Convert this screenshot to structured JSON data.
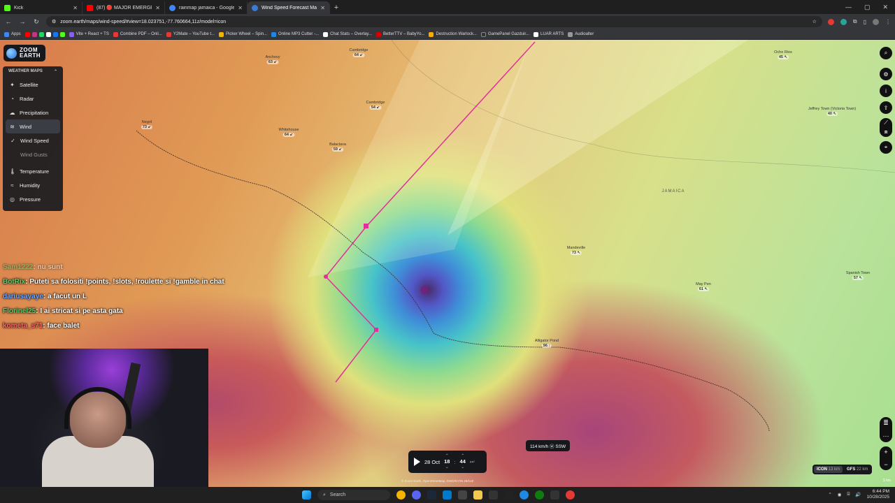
{
  "browser": {
    "tabs": [
      {
        "title": "Kick",
        "color": "#53fc18"
      },
      {
        "title": "(87) 🔴 MAJOR EMERGEN...",
        "color": "#ff0000"
      },
      {
        "title": "rainmap jamaica - Google Sear...",
        "color": "#4285f4"
      },
      {
        "title": "Wind Speed Forecast Map | Zo...",
        "color": "#3a7bd5"
      }
    ],
    "new_tab": "+",
    "url": "zoom.earth/maps/wind-speed/#view=18.023751,-77.760664,11z/model=icon",
    "bookmarks": [
      {
        "label": "Apps",
        "color": "#4285f4"
      },
      {
        "label": "",
        "color": "#ff0000"
      },
      {
        "label": "Vite + React + TS",
        "color": "#8b5cf6"
      },
      {
        "label": "Combine PDF – Onli...",
        "color": "#e53935"
      },
      {
        "label": "Y2Mate – YouTube t...",
        "color": "#e53935"
      },
      {
        "label": "Picker Wheel – Spin...",
        "color": "#f5b400"
      },
      {
        "label": "Online MP3 Cutter -...",
        "color": "#1e88e5"
      },
      {
        "label": "Chat Stats – Overlay...",
        "color": "#ffffff"
      },
      {
        "label": "BetterTTV – BabyYo...",
        "color": "#d50000"
      },
      {
        "label": "Destruction Warlock...",
        "color": "#ffaa00"
      },
      {
        "label": "GamePanel Gazduir...",
        "color": "#333333"
      },
      {
        "label": "LUAR ARTS",
        "color": "#ffffff"
      },
      {
        "label": "Audioalter",
        "color": "#999999"
      }
    ]
  },
  "app": {
    "logo_line1": "ZOOM",
    "logo_line2": "EARTH",
    "panel_header": "WEATHER MAPS",
    "layers": [
      {
        "label": "Satellite",
        "icon": "satellite-icon",
        "glyph": "✦"
      },
      {
        "label": "Radar",
        "icon": "radar-icon",
        "glyph": "◔"
      },
      {
        "label": "Precipitation",
        "icon": "cloud-rain-icon",
        "glyph": "☁"
      },
      {
        "label": "Wind",
        "icon": "wind-icon",
        "glyph": "≋"
      },
      {
        "label": "Wind Speed",
        "icon": "check-icon",
        "glyph": "✓"
      },
      {
        "label": "Wind Gusts",
        "icon": "",
        "glyph": ""
      },
      {
        "label": "Temperature",
        "icon": "thermometer-icon",
        "glyph": "🌡"
      },
      {
        "label": "Humidity",
        "icon": "humidity-icon",
        "glyph": "≈"
      },
      {
        "label": "Pressure",
        "icon": "pressure-gauge-icon",
        "glyph": "◎"
      }
    ]
  },
  "map": {
    "towns": [
      {
        "name": "Anchovy",
        "value": "63 ↙"
      },
      {
        "name": "Cambridge",
        "value": "64 ↙"
      },
      {
        "name": "Negril",
        "value": "73 ↙"
      },
      {
        "name": "Cambridge",
        "value": "54 ↙"
      },
      {
        "name": "Whitehouse",
        "value": "64 ↙"
      },
      {
        "name": "Balaclava",
        "value": "59 ↙"
      },
      {
        "name": "Ocho Rios",
        "value": "45 ↖"
      },
      {
        "name": "Jeffrey Town (Victoria Town)",
        "value": "40 ↖"
      },
      {
        "name": "JAMAICA",
        "value": ""
      },
      {
        "name": "Mandeville",
        "value": "73 ↖"
      },
      {
        "name": "May Pen",
        "value": "61 ↖"
      },
      {
        "name": "Spanish Town",
        "value": "57 ↖"
      },
      {
        "name": "Alligator Pond",
        "value": "96 ↑"
      }
    ],
    "tooltip": "114 km/h ⓦ SSW",
    "attribution": "© Zoom Earth, OpenStreetMap, DWD/ICON 28/12Z",
    "models": [
      {
        "name": "ICON",
        "res": "13 km"
      },
      {
        "name": "GFS",
        "res": "22 km"
      }
    ],
    "scale": "5 km"
  },
  "timeline": {
    "day": "28 Oct",
    "hour": "18",
    "minute": "44"
  },
  "chat": [
    {
      "user": "Sam1222",
      "msg": "nu sunt",
      "color": "u"
    },
    {
      "user": "BotRix",
      "msg": "Puteti sa folositi !points, !slots, !roulette si !gamble in chat",
      "color": "u"
    },
    {
      "user": "dariusayaye",
      "msg": "a facut un L",
      "color": "u2"
    },
    {
      "user": "Florinel25",
      "msg": "I ai stricat si pe asta gata",
      "color": "u"
    },
    {
      "user": "kometa_s71",
      "msg": "face balet",
      "color": "u3"
    }
  ],
  "taskbar": {
    "search": "Search",
    "time": "6:44 PM",
    "date": "10/28/2025"
  }
}
